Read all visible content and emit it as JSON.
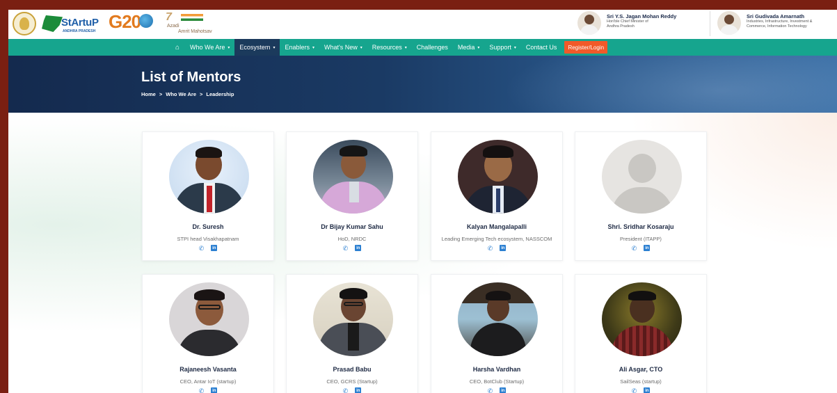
{
  "header": {
    "logos": [
      "StArtuP",
      "ANDHRA PRADESH",
      "G20",
      "7",
      "Azadi",
      "Amrit Mahotsav"
    ],
    "leaders": [
      {
        "name": "Sri Y.S. Jagan Mohan Reddy",
        "role_line1": "Hon'ble Chief Minister of",
        "role_line2": "Andhra Pradesh"
      },
      {
        "name": "Sri Gudivada Amarnath",
        "role_line1": "Industries, Infrastructure, Investment &",
        "role_line2": "Commerce, Information Technology"
      }
    ]
  },
  "nav": {
    "home_icon": "home-icon",
    "items": [
      {
        "label": "Who We Are",
        "dropdown": true
      },
      {
        "label": "Ecosystem",
        "dropdown": true,
        "active": true
      },
      {
        "label": "Enablers",
        "dropdown": true
      },
      {
        "label": "What's New",
        "dropdown": true
      },
      {
        "label": "Resources",
        "dropdown": true
      },
      {
        "label": "Challenges",
        "dropdown": false
      },
      {
        "label": "Media",
        "dropdown": true
      },
      {
        "label": "Support",
        "dropdown": true
      },
      {
        "label": "Contact Us",
        "dropdown": false
      }
    ],
    "register_label": "Register/Login",
    "caret": "▾"
  },
  "hero": {
    "title": "List of Mentors",
    "breadcrumb": [
      "Home",
      ">",
      "Who We Are",
      ">",
      "Leadership"
    ]
  },
  "mentors": [
    {
      "name": "Dr. Suresh",
      "role": "STPI head Visakhapatnam"
    },
    {
      "name": "Dr Bijay Kumar Sahu",
      "role": "HoD, NRDC"
    },
    {
      "name": "Kalyan Mangalapalli",
      "role": "Leading Emerging Tech ecosystem, NASSCOM"
    },
    {
      "name": "Shri. Sridhar Kosaraju",
      "role": "President (ITAPP)"
    },
    {
      "name": "Rajaneesh Vasanta",
      "role": "CEO, Antar IoT (startup)"
    },
    {
      "name": "Prasad Babu",
      "role": "CEO, GCRS (Startup)"
    },
    {
      "name": "Harsha Vardhan",
      "role": "CEO, BotClub (Startup)"
    },
    {
      "name": "Ali Asgar, CTO",
      "role": "SailSeas (startup)"
    }
  ],
  "icons": {
    "phone": "✆",
    "linkedin": "in"
  },
  "colors": {
    "nav_bg": "#16a58e",
    "nav_active": "#1b3a5c",
    "register": "#f15a29",
    "hero": "#1a3a64",
    "frame": "#7a1f12"
  }
}
